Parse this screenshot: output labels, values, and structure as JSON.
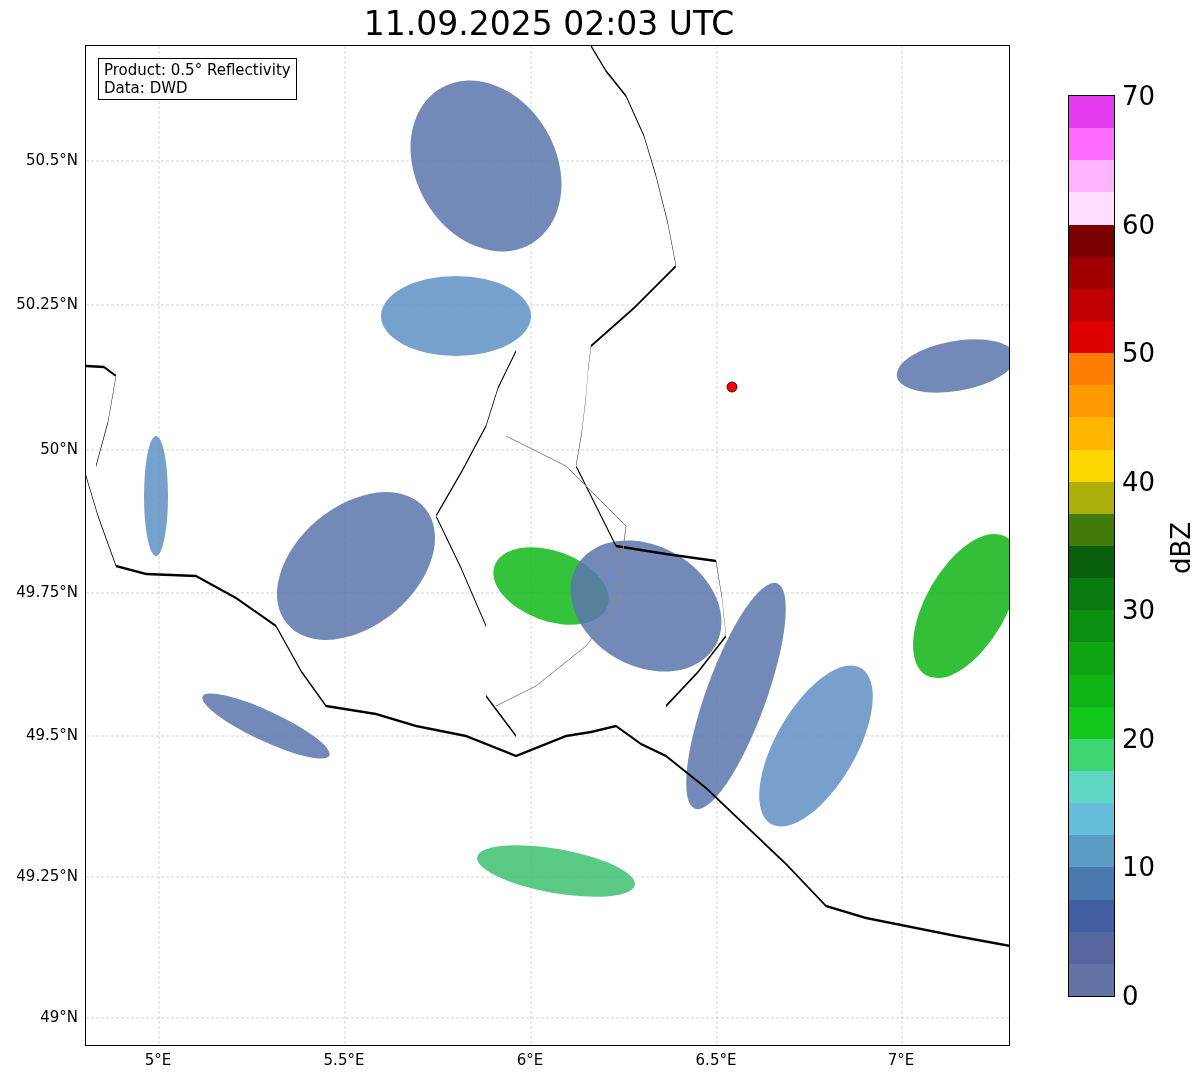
{
  "title": "11.09.2025 02:03 UTC",
  "info_box": [
    "Product: 0.5° Reflectivity",
    "Data: DWD"
  ],
  "lat_ticks": [
    "50.5°N",
    "50.25°N",
    "50°N",
    "49.75°N",
    "49.5°N",
    "49.25°N",
    "49°N"
  ],
  "lon_ticks": [
    "5°E",
    "5.5°E",
    "6°E",
    "6.5°E",
    "7°E"
  ],
  "colorbar": {
    "label": "dBZ",
    "ticks": [
      "70",
      "60",
      "50",
      "40",
      "30",
      "20",
      "10",
      "0"
    ],
    "segments": [
      {
        "color": "#e63cf0"
      },
      {
        "color": "#ff6cff"
      },
      {
        "color": "#ffb3ff"
      },
      {
        "color": "#ffddfe"
      },
      {
        "color": "#7a0000"
      },
      {
        "color": "#a00000"
      },
      {
        "color": "#c00000"
      },
      {
        "color": "#e00000"
      },
      {
        "color": "#ff7d00"
      },
      {
        "color": "#ff9900"
      },
      {
        "color": "#ffb600"
      },
      {
        "color": "#ffd700"
      },
      {
        "color": "#acae0a"
      },
      {
        "color": "#427a0a"
      },
      {
        "color": "#075f0c"
      },
      {
        "color": "#097a10"
      },
      {
        "color": "#0b8f12"
      },
      {
        "color": "#0ea414"
      },
      {
        "color": "#10b416"
      },
      {
        "color": "#12c81a"
      },
      {
        "color": "#3dd670"
      },
      {
        "color": "#5fd6c6"
      },
      {
        "color": "#66bedd"
      },
      {
        "color": "#599cc5"
      },
      {
        "color": "#4a79b0"
      },
      {
        "color": "#425ea3"
      },
      {
        "color": "#5667a0"
      },
      {
        "color": "#6473a6"
      }
    ]
  }
}
